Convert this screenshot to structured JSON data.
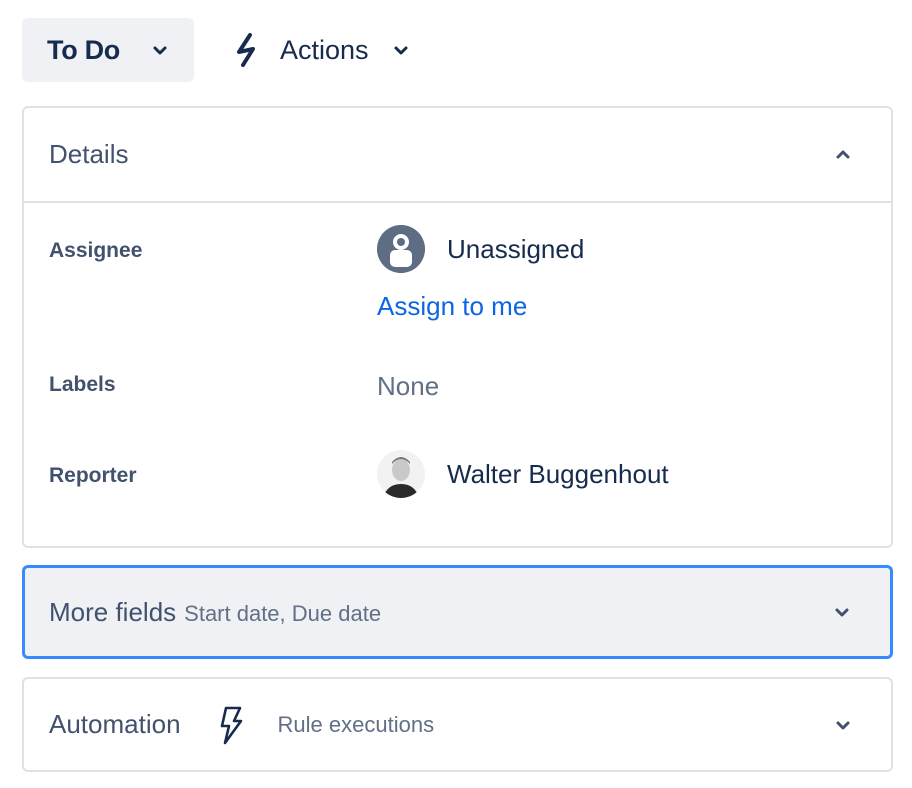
{
  "toolbar": {
    "status_label": "To Do",
    "status_icon": "chevron-down-icon",
    "actions_label": "Actions",
    "actions_icon": "lightning-icon"
  },
  "details": {
    "title": "Details",
    "collapse_icon": "chevron-up-icon",
    "fields": {
      "assignee": {
        "label": "Assignee",
        "value": "Unassigned",
        "action": "Assign to me"
      },
      "labels": {
        "label": "Labels",
        "value": "None"
      },
      "reporter": {
        "label": "Reporter",
        "value": "Walter Buggenhout"
      }
    }
  },
  "more_fields": {
    "title": "More fields",
    "subtitle": "Start date, Due date"
  },
  "automation": {
    "title": "Automation",
    "subtitle": "Rule executions"
  },
  "colors": {
    "text_primary": "#172b4d",
    "text_secondary": "#42526e",
    "link": "#0c66e4",
    "focus_border": "#388bff",
    "button_bg": "#f0f1f4",
    "border": "#dfe1e6"
  }
}
